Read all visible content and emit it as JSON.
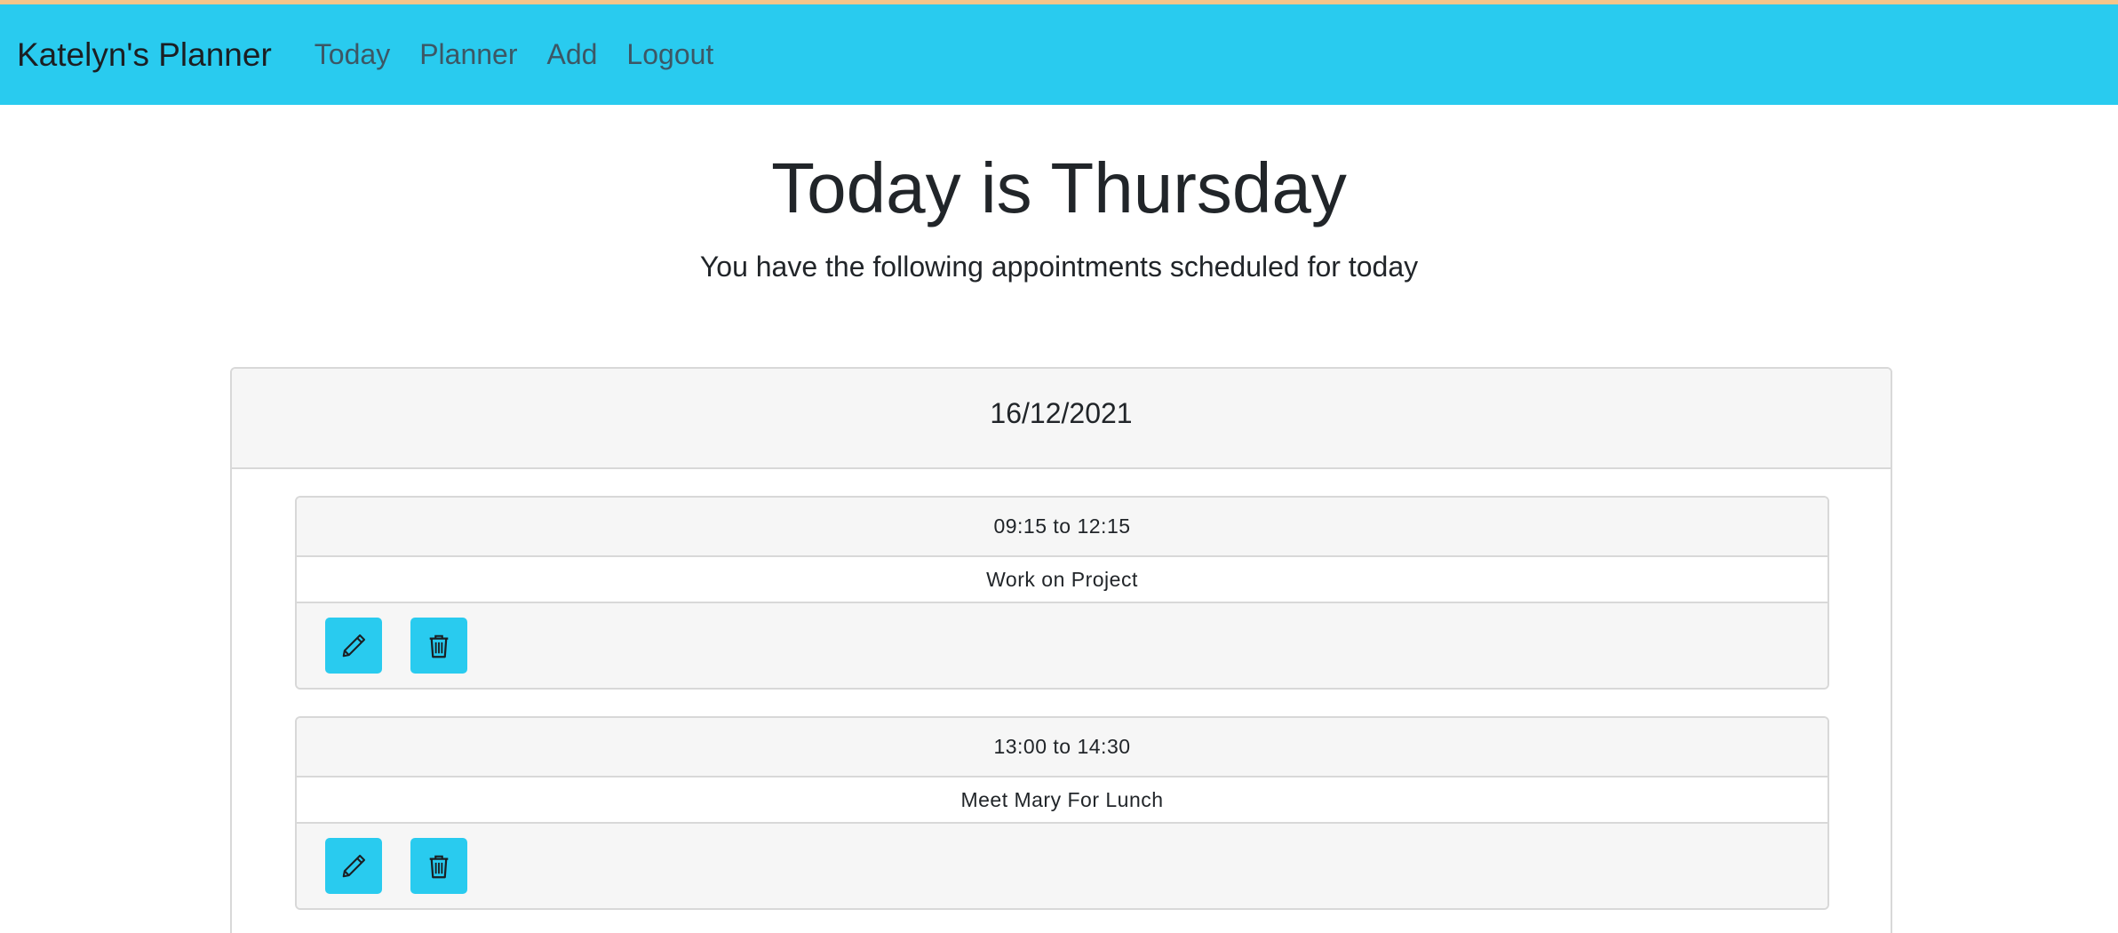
{
  "navbar": {
    "brand": "Katelyn's Planner",
    "links": [
      "Today",
      "Planner",
      "Add",
      "Logout"
    ],
    "background": "#29cbef"
  },
  "main": {
    "title": "Today is Thursday",
    "subtitle": "You have the following appointments scheduled for today"
  },
  "day": {
    "date": "16/12/2021",
    "appointments": [
      {
        "time": "09:15 to 12:15",
        "description": "Work on Project",
        "edit_icon": "pencil-icon",
        "delete_icon": "trash-icon"
      },
      {
        "time": "13:00 to 14:30",
        "description": "Meet Mary For Lunch",
        "edit_icon": "pencil-icon",
        "delete_icon": "trash-icon"
      }
    ]
  }
}
